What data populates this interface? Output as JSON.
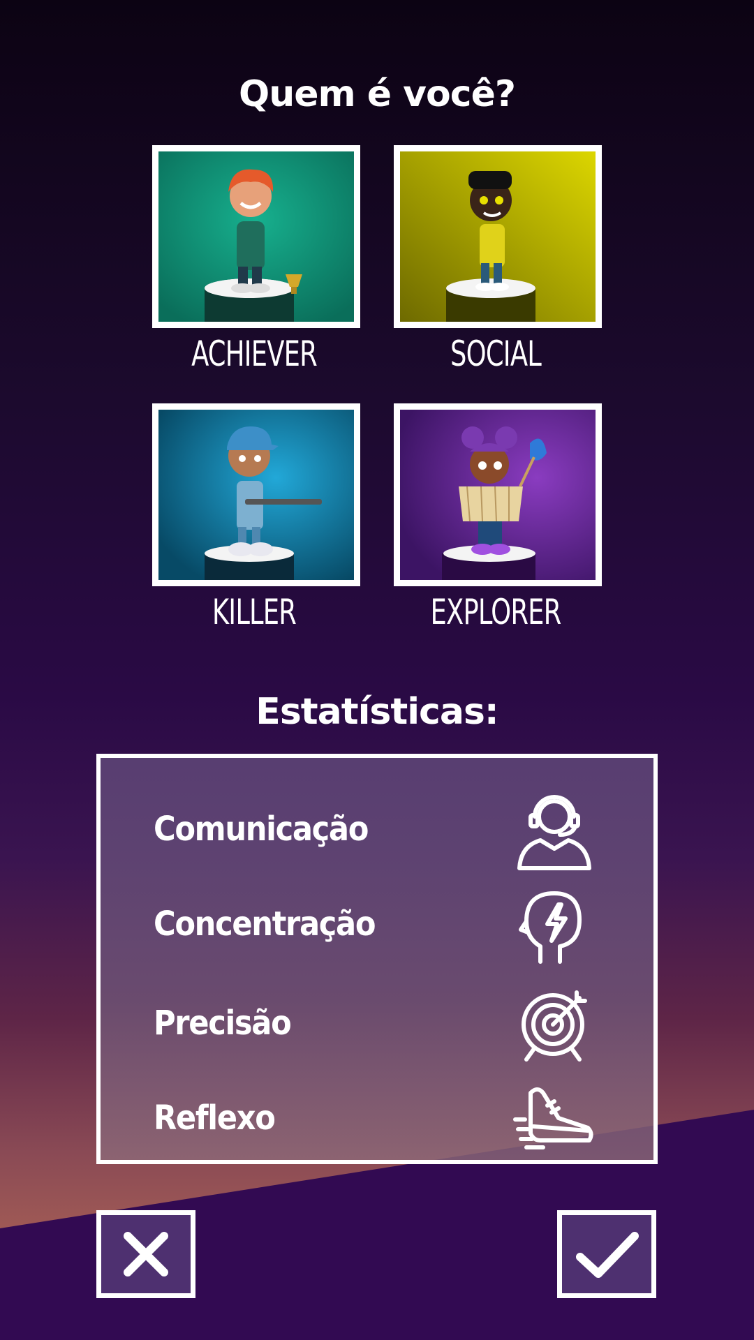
{
  "header": {
    "title": "Quem é você?"
  },
  "profiles": [
    {
      "label": "ACHIEVER",
      "color": "#0e9a7d"
    },
    {
      "label": "SOCIAL",
      "color": "#c6c200"
    },
    {
      "label": "KILLER",
      "color": "#1188bb"
    },
    {
      "label": "EXPLORER",
      "color": "#6a2a9e"
    }
  ],
  "stats": {
    "title": "Estatísticas:",
    "items": [
      {
        "label": "Comunicação",
        "icon": "headset-person-icon"
      },
      {
        "label": "Concentração",
        "icon": "head-lightning-icon"
      },
      {
        "label": "Precisão",
        "icon": "target-icon"
      },
      {
        "label": "Reflexo",
        "icon": "running-shoe-icon"
      }
    ]
  },
  "actions": {
    "cancel_icon": "close-icon",
    "confirm_icon": "checkmark-icon"
  }
}
